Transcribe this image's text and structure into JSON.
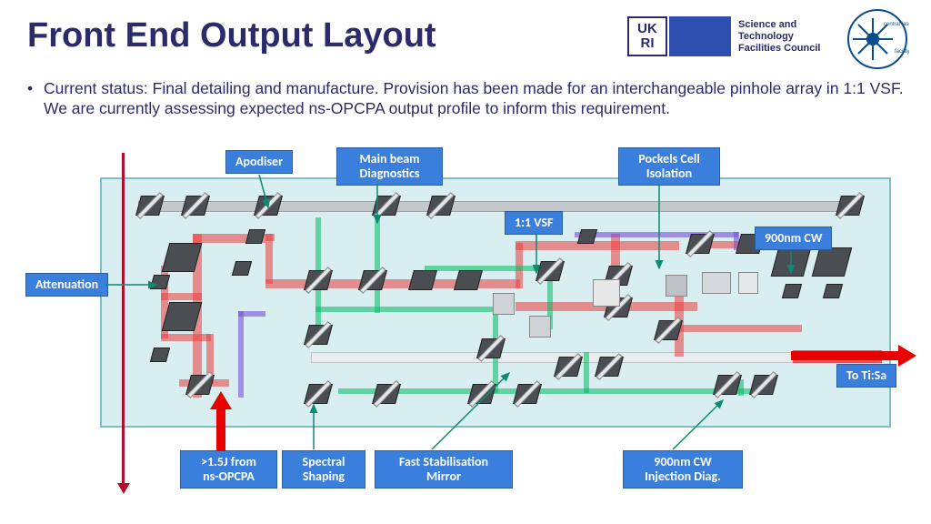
{
  "title": "Front End Output Layout",
  "branding": {
    "ukri": "UK\nRI",
    "stfc_line1": "Science and",
    "stfc_line2": "Technology",
    "stfc_line3": "Facilities Council",
    "clf": "central laser facility"
  },
  "bullet_text": "Current status: Final detailing and manufacture. Provision has been made for an interchangeable pinhole array in 1:1 VSF. We are currently assessing expected ns-OPCPA output profile to inform this requirement.",
  "labels": {
    "attenuation": "Attenuation",
    "apodiser": "Apodiser",
    "main_diag": "Main beam\nDiagnostics",
    "vsf": "1:1 VSF",
    "pockels": "Pockels Cell\nIsolation",
    "cw": "900nm CW",
    "to_tisa": "To Ti:Sa",
    "input": ">1.5J from\nns-OPCPA",
    "spectral": "Spectral\nShaping",
    "fast_stab": "Fast Stabilisation\nMirror",
    "cw_inj": "900nm CW\nInjection Diag."
  }
}
